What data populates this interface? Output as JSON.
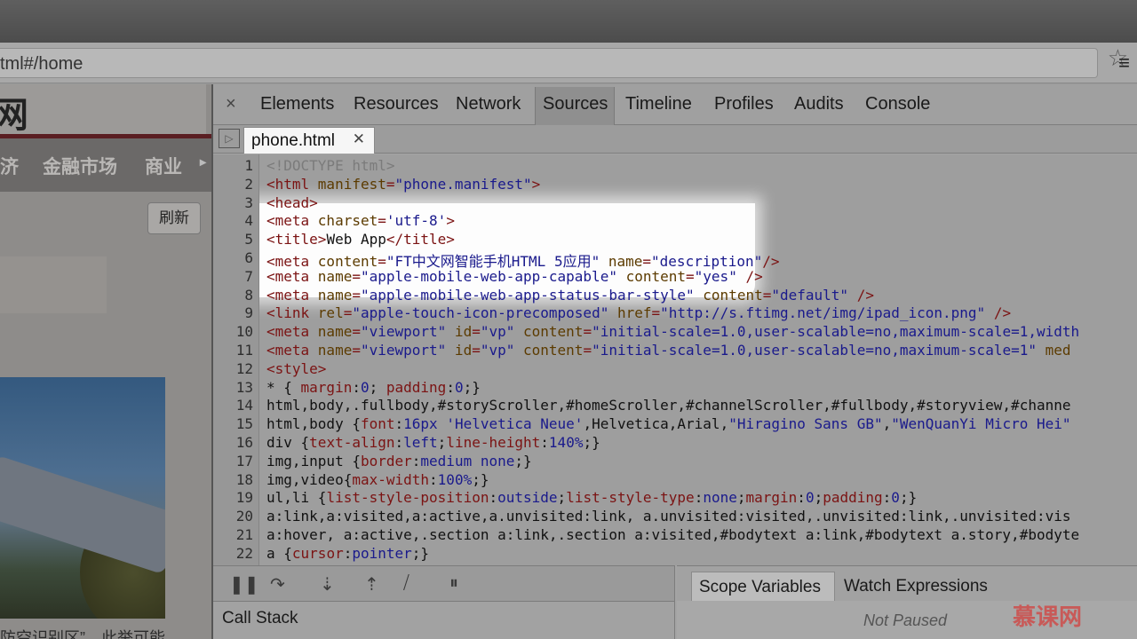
{
  "browser": {
    "url": "tml#/home",
    "star_icon": "star-icon",
    "menu_icon": "hamburger-menu-icon"
  },
  "webpage": {
    "logo_char": "网",
    "nav": [
      "济",
      "金融市场",
      "商业"
    ],
    "refresh_label": "刷新",
    "caption": "防空识别区”，此举可能"
  },
  "devtools": {
    "tabs": [
      "Elements",
      "Resources",
      "Network",
      "Sources",
      "Timeline",
      "Profiles",
      "Audits",
      "Console"
    ],
    "active_tab": "Sources",
    "file_tab": "phone.html",
    "lines": [
      {
        "n": "1",
        "segs": [
          {
            "t": "<!DOCTYPE html>",
            "c": "com"
          }
        ]
      },
      {
        "n": "2",
        "segs": [
          {
            "t": "<html ",
            "c": "tag"
          },
          {
            "t": "manifest",
            "c": "attr"
          },
          {
            "t": "=",
            "c": "tag"
          },
          {
            "t": "\"phone.manifest\"",
            "c": "str"
          },
          {
            "t": ">",
            "c": "tag"
          }
        ]
      },
      {
        "n": "3",
        "segs": [
          {
            "t": "<head>",
            "c": "tag"
          }
        ]
      },
      {
        "n": "4",
        "segs": [
          {
            "t": "<meta ",
            "c": "tag"
          },
          {
            "t": "charset",
            "c": "attr"
          },
          {
            "t": "=",
            "c": "tag"
          },
          {
            "t": "'utf-8'",
            "c": "str"
          },
          {
            "t": ">",
            "c": "tag"
          }
        ]
      },
      {
        "n": "5",
        "segs": [
          {
            "t": "<title>",
            "c": "tag"
          },
          {
            "t": "Web App",
            "c": ""
          },
          {
            "t": "</title>",
            "c": "tag"
          }
        ]
      },
      {
        "n": "6",
        "segs": [
          {
            "t": "<meta ",
            "c": "tag"
          },
          {
            "t": "content",
            "c": "attr"
          },
          {
            "t": "=",
            "c": "tag"
          },
          {
            "t": "\"FT中文网智能手机HTML 5应用\"",
            "c": "str"
          },
          {
            "t": " name",
            "c": "attr"
          },
          {
            "t": "=",
            "c": "tag"
          },
          {
            "t": "\"description\"",
            "c": "str"
          },
          {
            "t": "/>",
            "c": "tag"
          }
        ]
      },
      {
        "n": "7",
        "segs": [
          {
            "t": "<meta ",
            "c": "tag"
          },
          {
            "t": "name",
            "c": "attr"
          },
          {
            "t": "=",
            "c": "tag"
          },
          {
            "t": "\"apple-mobile-web-app-capable\"",
            "c": "str"
          },
          {
            "t": " content",
            "c": "attr"
          },
          {
            "t": "=",
            "c": "tag"
          },
          {
            "t": "\"yes\"",
            "c": "str"
          },
          {
            "t": " />",
            "c": "tag"
          }
        ]
      },
      {
        "n": "8",
        "segs": [
          {
            "t": "<meta ",
            "c": "tag"
          },
          {
            "t": "name",
            "c": "attr"
          },
          {
            "t": "=",
            "c": "tag"
          },
          {
            "t": "\"apple-mobile-web-app-status-bar-style\"",
            "c": "str"
          },
          {
            "t": " content",
            "c": "attr"
          },
          {
            "t": "=",
            "c": "tag"
          },
          {
            "t": "\"default\"",
            "c": "str"
          },
          {
            "t": " />",
            "c": "tag"
          }
        ]
      },
      {
        "n": "9",
        "segs": [
          {
            "t": "<link ",
            "c": "tag"
          },
          {
            "t": "rel",
            "c": "attr"
          },
          {
            "t": "=",
            "c": "tag"
          },
          {
            "t": "\"apple-touch-icon-precomposed\"",
            "c": "str"
          },
          {
            "t": " href",
            "c": "attr"
          },
          {
            "t": "=",
            "c": "tag"
          },
          {
            "t": "\"http://s.ftimg.net/img/ipad_icon.png\"",
            "c": "str"
          },
          {
            "t": " />",
            "c": "tag"
          }
        ]
      },
      {
        "n": "10",
        "segs": [
          {
            "t": "<meta ",
            "c": "tag"
          },
          {
            "t": "name",
            "c": "attr"
          },
          {
            "t": "=",
            "c": "tag"
          },
          {
            "t": "\"viewport\"",
            "c": "str"
          },
          {
            "t": " id",
            "c": "attr"
          },
          {
            "t": "=",
            "c": "tag"
          },
          {
            "t": "\"vp\"",
            "c": "str"
          },
          {
            "t": " content",
            "c": "attr"
          },
          {
            "t": "=",
            "c": "tag"
          },
          {
            "t": "\"initial-scale=1.0,user-scalable=no,maximum-scale=1,width",
            "c": "str"
          }
        ]
      },
      {
        "n": "11",
        "segs": [
          {
            "t": "<meta ",
            "c": "tag"
          },
          {
            "t": "name",
            "c": "attr"
          },
          {
            "t": "=",
            "c": "tag"
          },
          {
            "t": "\"viewport\"",
            "c": "str"
          },
          {
            "t": " id",
            "c": "attr"
          },
          {
            "t": "=",
            "c": "tag"
          },
          {
            "t": "\"vp\"",
            "c": "str"
          },
          {
            "t": " content",
            "c": "attr"
          },
          {
            "t": "=",
            "c": "tag"
          },
          {
            "t": "\"initial-scale=1.0,user-scalable=no,maximum-scale=1\"",
            "c": "str"
          },
          {
            "t": " med",
            "c": "attr"
          }
        ]
      },
      {
        "n": "12",
        "segs": [
          {
            "t": "<style>",
            "c": "tag"
          }
        ]
      },
      {
        "n": "13",
        "segs": [
          {
            "t": "* { ",
            "c": ""
          },
          {
            "t": "margin",
            "c": "prop"
          },
          {
            "t": ":",
            "c": ""
          },
          {
            "t": "0",
            "c": "val"
          },
          {
            "t": "; ",
            "c": ""
          },
          {
            "t": "padding",
            "c": "prop"
          },
          {
            "t": ":",
            "c": ""
          },
          {
            "t": "0",
            "c": "val"
          },
          {
            "t": ";}",
            "c": ""
          }
        ]
      },
      {
        "n": "14",
        "segs": [
          {
            "t": "html,body,.fullbody,#storyScroller,#homeScroller,#channelScroller,#fullbody,#storyview,#channe",
            "c": ""
          }
        ]
      },
      {
        "n": "15",
        "segs": [
          {
            "t": "html,body {",
            "c": ""
          },
          {
            "t": "font",
            "c": "prop"
          },
          {
            "t": ":",
            "c": ""
          },
          {
            "t": "16px ",
            "c": "val"
          },
          {
            "t": "'Helvetica Neue'",
            "c": "str"
          },
          {
            "t": ",Helvetica,Arial,",
            "c": ""
          },
          {
            "t": "\"Hiragino Sans GB\"",
            "c": "str"
          },
          {
            "t": ",",
            "c": ""
          },
          {
            "t": "\"WenQuanYi Micro Hei\"",
            "c": "str"
          }
        ]
      },
      {
        "n": "16",
        "segs": [
          {
            "t": "div {",
            "c": ""
          },
          {
            "t": "text-align",
            "c": "prop"
          },
          {
            "t": ":",
            "c": ""
          },
          {
            "t": "left",
            "c": "val"
          },
          {
            "t": ";",
            "c": ""
          },
          {
            "t": "line-height",
            "c": "prop"
          },
          {
            "t": ":",
            "c": ""
          },
          {
            "t": "140%",
            "c": "val"
          },
          {
            "t": ";}",
            "c": ""
          }
        ]
      },
      {
        "n": "17",
        "segs": [
          {
            "t": "img,input {",
            "c": ""
          },
          {
            "t": "border",
            "c": "prop"
          },
          {
            "t": ":",
            "c": ""
          },
          {
            "t": "medium none",
            "c": "val"
          },
          {
            "t": ";}",
            "c": ""
          }
        ]
      },
      {
        "n": "18",
        "segs": [
          {
            "t": "img,video{",
            "c": ""
          },
          {
            "t": "max-width",
            "c": "prop"
          },
          {
            "t": ":",
            "c": ""
          },
          {
            "t": "100%",
            "c": "val"
          },
          {
            "t": ";}",
            "c": ""
          }
        ]
      },
      {
        "n": "19",
        "segs": [
          {
            "t": "ul,li {",
            "c": ""
          },
          {
            "t": "list-style-position",
            "c": "prop"
          },
          {
            "t": ":",
            "c": ""
          },
          {
            "t": "outside",
            "c": "val"
          },
          {
            "t": ";",
            "c": ""
          },
          {
            "t": "list-style-type",
            "c": "prop"
          },
          {
            "t": ":",
            "c": ""
          },
          {
            "t": "none",
            "c": "val"
          },
          {
            "t": ";",
            "c": ""
          },
          {
            "t": "margin",
            "c": "prop"
          },
          {
            "t": ":",
            "c": ""
          },
          {
            "t": "0",
            "c": "val"
          },
          {
            "t": ";",
            "c": ""
          },
          {
            "t": "padding",
            "c": "prop"
          },
          {
            "t": ":",
            "c": ""
          },
          {
            "t": "0",
            "c": "val"
          },
          {
            "t": ";}",
            "c": ""
          }
        ]
      },
      {
        "n": "20",
        "segs": [
          {
            "t": "a:link,a:visited,a:active,a.unvisited:link, a.unvisited:visited,.unvisited:link,.unvisited:vis",
            "c": ""
          }
        ]
      },
      {
        "n": "21",
        "segs": [
          {
            "t": "a:hover, a:active,.section a:link,.section a:visited,#bodytext a:link,#bodytext a.story,#bodyte",
            "c": ""
          }
        ]
      },
      {
        "n": "22",
        "segs": [
          {
            "t": "a {",
            "c": ""
          },
          {
            "t": "cursor",
            "c": "prop"
          },
          {
            "t": ":",
            "c": ""
          },
          {
            "t": "pointer",
            "c": "val"
          },
          {
            "t": ";}",
            "c": ""
          }
        ]
      }
    ],
    "callstack_label": "Call Stack",
    "scope_tab": "Scope Variables",
    "watch_tab": "Watch Expressions",
    "not_paused": "Not Paused"
  },
  "watermark": "慕课网",
  "colors": {
    "tag": "#7b1313",
    "attr": "#5c3b00",
    "string": "#1a1a8c",
    "comment": "#7b7b7b"
  }
}
